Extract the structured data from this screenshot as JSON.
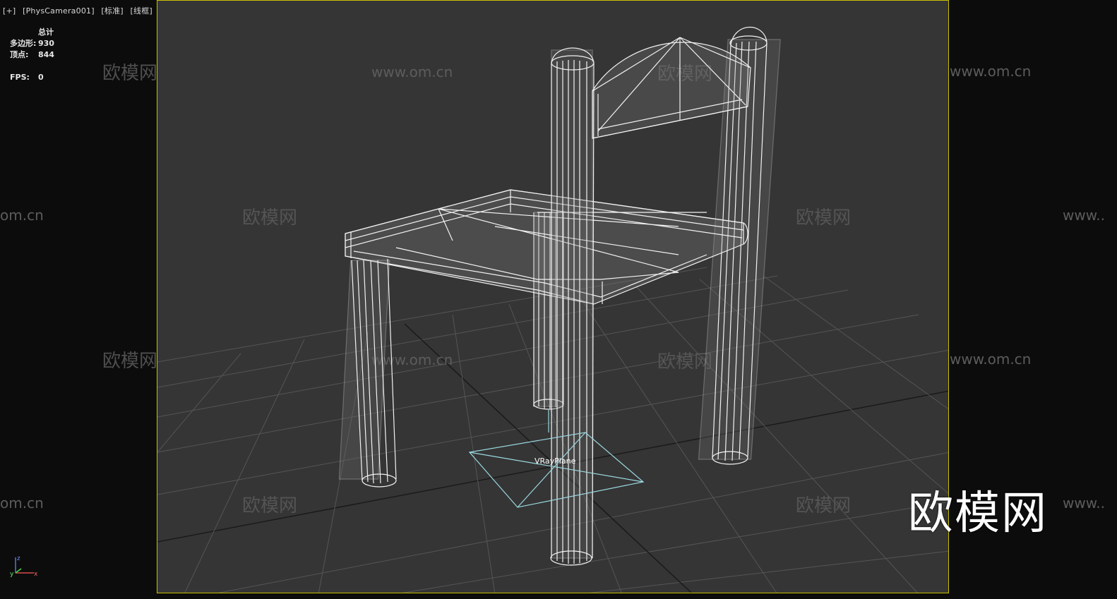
{
  "viewport_label": {
    "plus": "[+]",
    "camera": "[PhysCamera001]",
    "mode": "[标准]",
    "shading": "[线框]"
  },
  "stats": {
    "header": "总计",
    "polygons_label": "多边形:",
    "polygons_value": "930",
    "vertices_label": "顶点:",
    "vertices_value": "844",
    "fps_label": "FPS:",
    "fps_value": "0"
  },
  "scene": {
    "object_label": "VRayPlane",
    "wireframe_color": "#ffffff",
    "plane_color": "#9ad8e0",
    "grid_color": "#555555",
    "viewport_border_color": "#c8c000"
  },
  "watermarks": {
    "logo_text": "欧模网",
    "url_text": "www.om.cn",
    "url_fragment_left": "om.cn",
    "url_fragment_right": "www..",
    "big_logo": "欧模网"
  },
  "axis_gizmo": {
    "x": "x",
    "y": "y",
    "z": "z"
  }
}
